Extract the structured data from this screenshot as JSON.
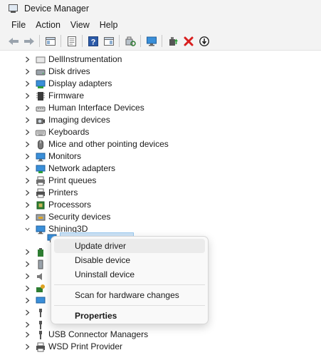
{
  "window": {
    "title": "Device Manager"
  },
  "menu": [
    "File",
    "Action",
    "View",
    "Help"
  ],
  "toolbar": {
    "icons": [
      "back-icon",
      "forward-icon",
      "show-hide-icon",
      "properties-sheet-icon",
      "help-icon",
      "action-pane-icon",
      "scan-hardware-icon",
      "monitor-icon",
      "update-driver-icon",
      "uninstall-icon",
      "disable-icon"
    ]
  },
  "tree": {
    "categories": [
      {
        "label": "DellInstrumentation",
        "icon": "dell-icon",
        "expanded": false
      },
      {
        "label": "Disk drives",
        "icon": "disk-drive-icon",
        "expanded": false
      },
      {
        "label": "Display adapters",
        "icon": "display-adapter-icon",
        "expanded": false
      },
      {
        "label": "Firmware",
        "icon": "firmware-icon",
        "expanded": false
      },
      {
        "label": "Human Interface Devices",
        "icon": "hid-icon",
        "expanded": false
      },
      {
        "label": "Imaging devices",
        "icon": "camera-icon",
        "expanded": false
      },
      {
        "label": "Keyboards",
        "icon": "keyboard-icon",
        "expanded": false
      },
      {
        "label": "Mice and other pointing devices",
        "icon": "mouse-icon",
        "expanded": false
      },
      {
        "label": "Monitors",
        "icon": "monitor-icon",
        "expanded": false
      },
      {
        "label": "Network adapters",
        "icon": "network-icon",
        "expanded": false
      },
      {
        "label": "Print queues",
        "icon": "print-queue-icon",
        "expanded": false
      },
      {
        "label": "Printers",
        "icon": "printer-icon",
        "expanded": false
      },
      {
        "label": "Processors",
        "icon": "processor-icon",
        "expanded": false
      },
      {
        "label": "Security devices",
        "icon": "security-icon",
        "expanded": false
      },
      {
        "label": "Shining3D",
        "icon": "device-icon",
        "expanded": true
      }
    ],
    "bottom": [
      {
        "label": "USB Connector Managers",
        "icon": "usb-icon"
      },
      {
        "label": "WSD Print Provider",
        "icon": "wsd-printer-icon"
      }
    ]
  },
  "context_menu": {
    "update": "Update driver",
    "disable": "Disable device",
    "uninstall": "Uninstall device",
    "scan": "Scan for hardware changes",
    "properties": "Properties"
  },
  "colors": {
    "accent": "#0078d4",
    "selection": "#cce4f7",
    "menu_hover": "#ebebeb",
    "delete_red": "#d81e1e"
  }
}
